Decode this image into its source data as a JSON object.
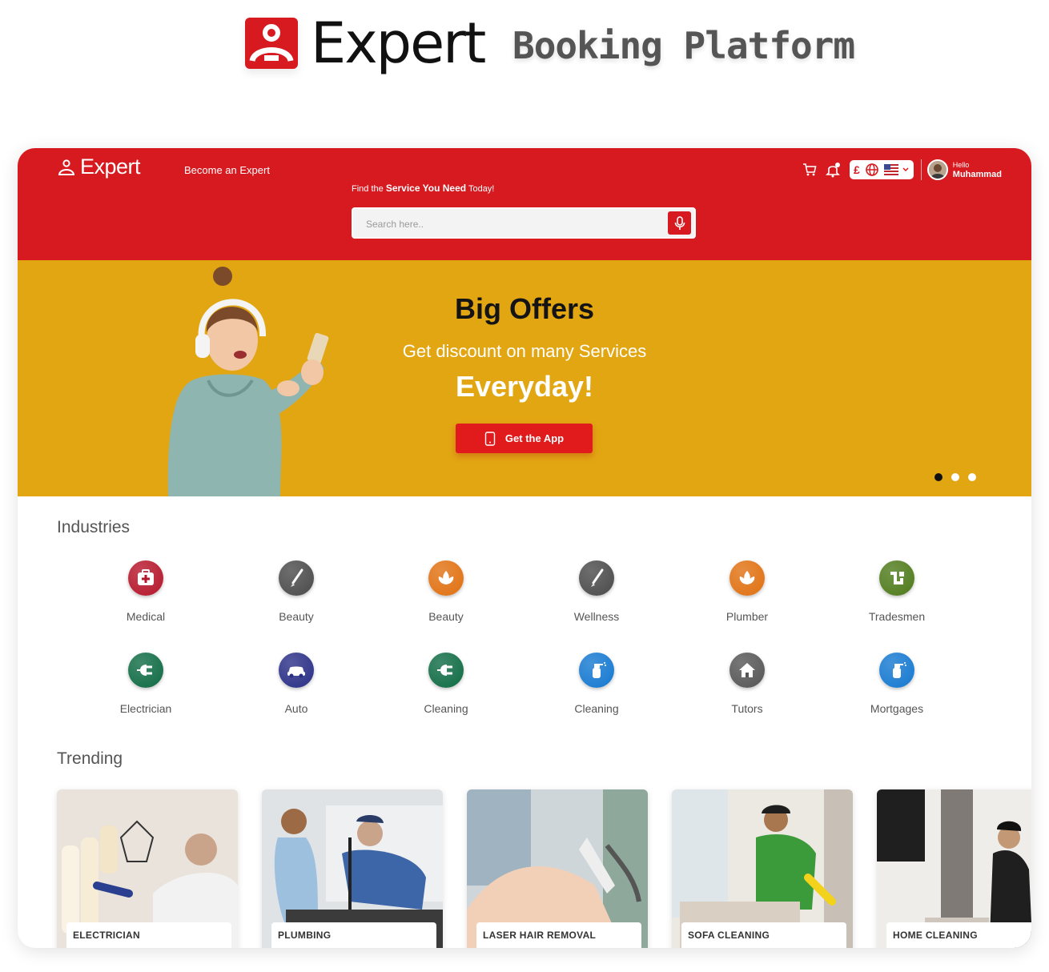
{
  "branding": {
    "name": "Expert",
    "subtitle": "Booking Platform"
  },
  "header": {
    "logo_text": "Expert",
    "become_expert": "Become an Expert",
    "search_caption_prefix": "Find the",
    "search_caption_bold": "Service You Need",
    "search_caption_suffix": "Today!",
    "search_placeholder": "Search here..",
    "currency_symbol": "£",
    "user_greeting": "Hello",
    "user_name": "Muhammad"
  },
  "banner": {
    "title": "Big Offers",
    "subtitle": "Get discount on many Services",
    "headline": "Everyday!",
    "cta": "Get the App",
    "slides": 3,
    "active_slide": 1
  },
  "industries": {
    "title": "Industries",
    "items": [
      {
        "label": "Medical",
        "icon": "medical-kit-icon",
        "color": "#b5162b"
      },
      {
        "label": "Beauty",
        "icon": "brush-icon",
        "color": "#4a4a4a"
      },
      {
        "label": "Beauty",
        "icon": "lotus-icon",
        "color": "#e07010"
      },
      {
        "label": "Wellness",
        "icon": "brush-icon",
        "color": "#4a4a4a"
      },
      {
        "label": "Plumber",
        "icon": "lotus-icon",
        "color": "#e07010"
      },
      {
        "label": "Tradesmen",
        "icon": "pipe-icon",
        "color": "#4e7a1a"
      },
      {
        "label": "Electrician",
        "icon": "plug-icon",
        "color": "#0f6b44"
      },
      {
        "label": "Auto",
        "icon": "car-icon",
        "color": "#2a2f86"
      },
      {
        "label": "Cleaning",
        "icon": "plug-icon",
        "color": "#0f6b44"
      },
      {
        "label": "Cleaning",
        "icon": "spray-bottle-icon",
        "color": "#1478d0"
      },
      {
        "label": "Tutors",
        "icon": "house-icon",
        "color": "#555555"
      },
      {
        "label": "Mortgages",
        "icon": "spray-bottle-icon",
        "color": "#1478d0"
      }
    ]
  },
  "trending": {
    "title": "Trending",
    "cards": [
      {
        "label": "ELECTRICIAN"
      },
      {
        "label": "PLUMBING"
      },
      {
        "label": "LASER HAIR REMOVAL"
      },
      {
        "label": "SOFA CLEANING"
      },
      {
        "label": "HOME CLEANING"
      }
    ]
  },
  "colors": {
    "brand_red": "#d71920",
    "banner_yellow": "#e2a613"
  }
}
